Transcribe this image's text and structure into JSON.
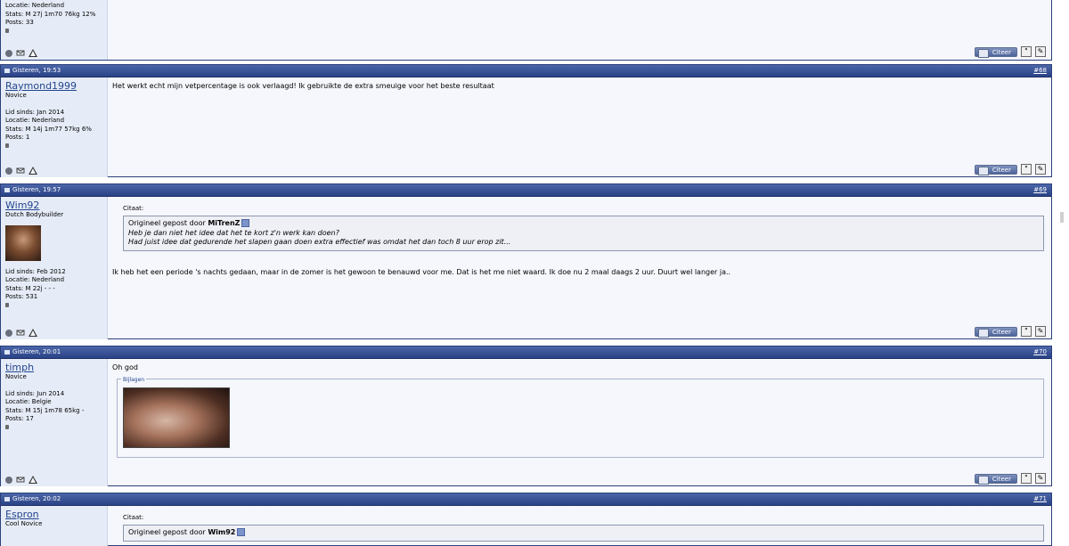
{
  "posts": [
    {
      "date": "",
      "number": "",
      "username": "",
      "usertitle": "",
      "stats": [
        "Locatie: Nederland",
        "Stats: M 27j 1m70 76kg 12%",
        "Posts: 33"
      ],
      "message": "",
      "quote_label": "Citeer"
    },
    {
      "date": "Gisteren, 19:53",
      "number": "#68",
      "username": "Raymond1999",
      "usertitle": "Novice",
      "stats": [
        "Lid sinds: Jan 2014",
        "Locatie: Nederland",
        "Stats: M 14j 1m77 57kg 6%",
        "Posts: 1"
      ],
      "message": "Het werkt echt mijn vetpercentage is ook verlaagd! Ik gebruikte de extra smeuige voor het beste resultaat",
      "quote_label": "Citeer"
    },
    {
      "date": "Gisteren, 19:57",
      "number": "#69",
      "username": "Wim92",
      "usertitle": "Dutch Bodybuilder",
      "stats": [
        "Lid sinds: Feb 2012",
        "Locatie: Nederland",
        "Stats: M 22j - - -",
        "Posts: 531"
      ],
      "quote": {
        "label": "Citaat:",
        "prefix": "Origineel gepost door ",
        "author": "MiTrenZ",
        "lines": [
          "Heb je dan niet het idee dat het te kort z'n werk kan doen?",
          "Had juist idee dat gedurende het slapen gaan doen extra effectief was omdat het dan toch 8 uur erop zit..."
        ]
      },
      "message": "Ik heb het een periode 's nachts gedaan, maar in de zomer is het gewoon te benauwd voor me. Dat is het me niet waard. Ik doe nu 2 maal daags 2 uur. Duurt wel langer ja..",
      "quote_label": "Citeer"
    },
    {
      "date": "Gisteren, 20:01",
      "number": "#70",
      "username": "timph",
      "usertitle": "Novice",
      "stats": [
        "Lid sinds: Jun 2014",
        "Locatie: Belgie",
        "Stats: M 15j 1m78 65kg -",
        "Posts: 17"
      ],
      "message": "Oh god",
      "attachments_label": "Bijlagen",
      "quote_label": "Citeer"
    },
    {
      "date": "Gisteren, 20:02",
      "number": "#71",
      "username": "Espron",
      "usertitle": "Cool Novice",
      "quote": {
        "label": "Citaat:",
        "prefix": "Origineel gepost door ",
        "author": "Wim92"
      }
    }
  ],
  "icons": {
    "online": "circle-icon",
    "message": "message-icon",
    "report": "warning-icon",
    "multiquote": "multiquote-icon",
    "edit": "edit-icon",
    "view_post": "view-post-icon"
  },
  "colors": {
    "header_bar": "#2a4286",
    "userinfo_bg": "#e6ecf7",
    "post_bg": "#f5f7fc",
    "link": "#22458e"
  }
}
